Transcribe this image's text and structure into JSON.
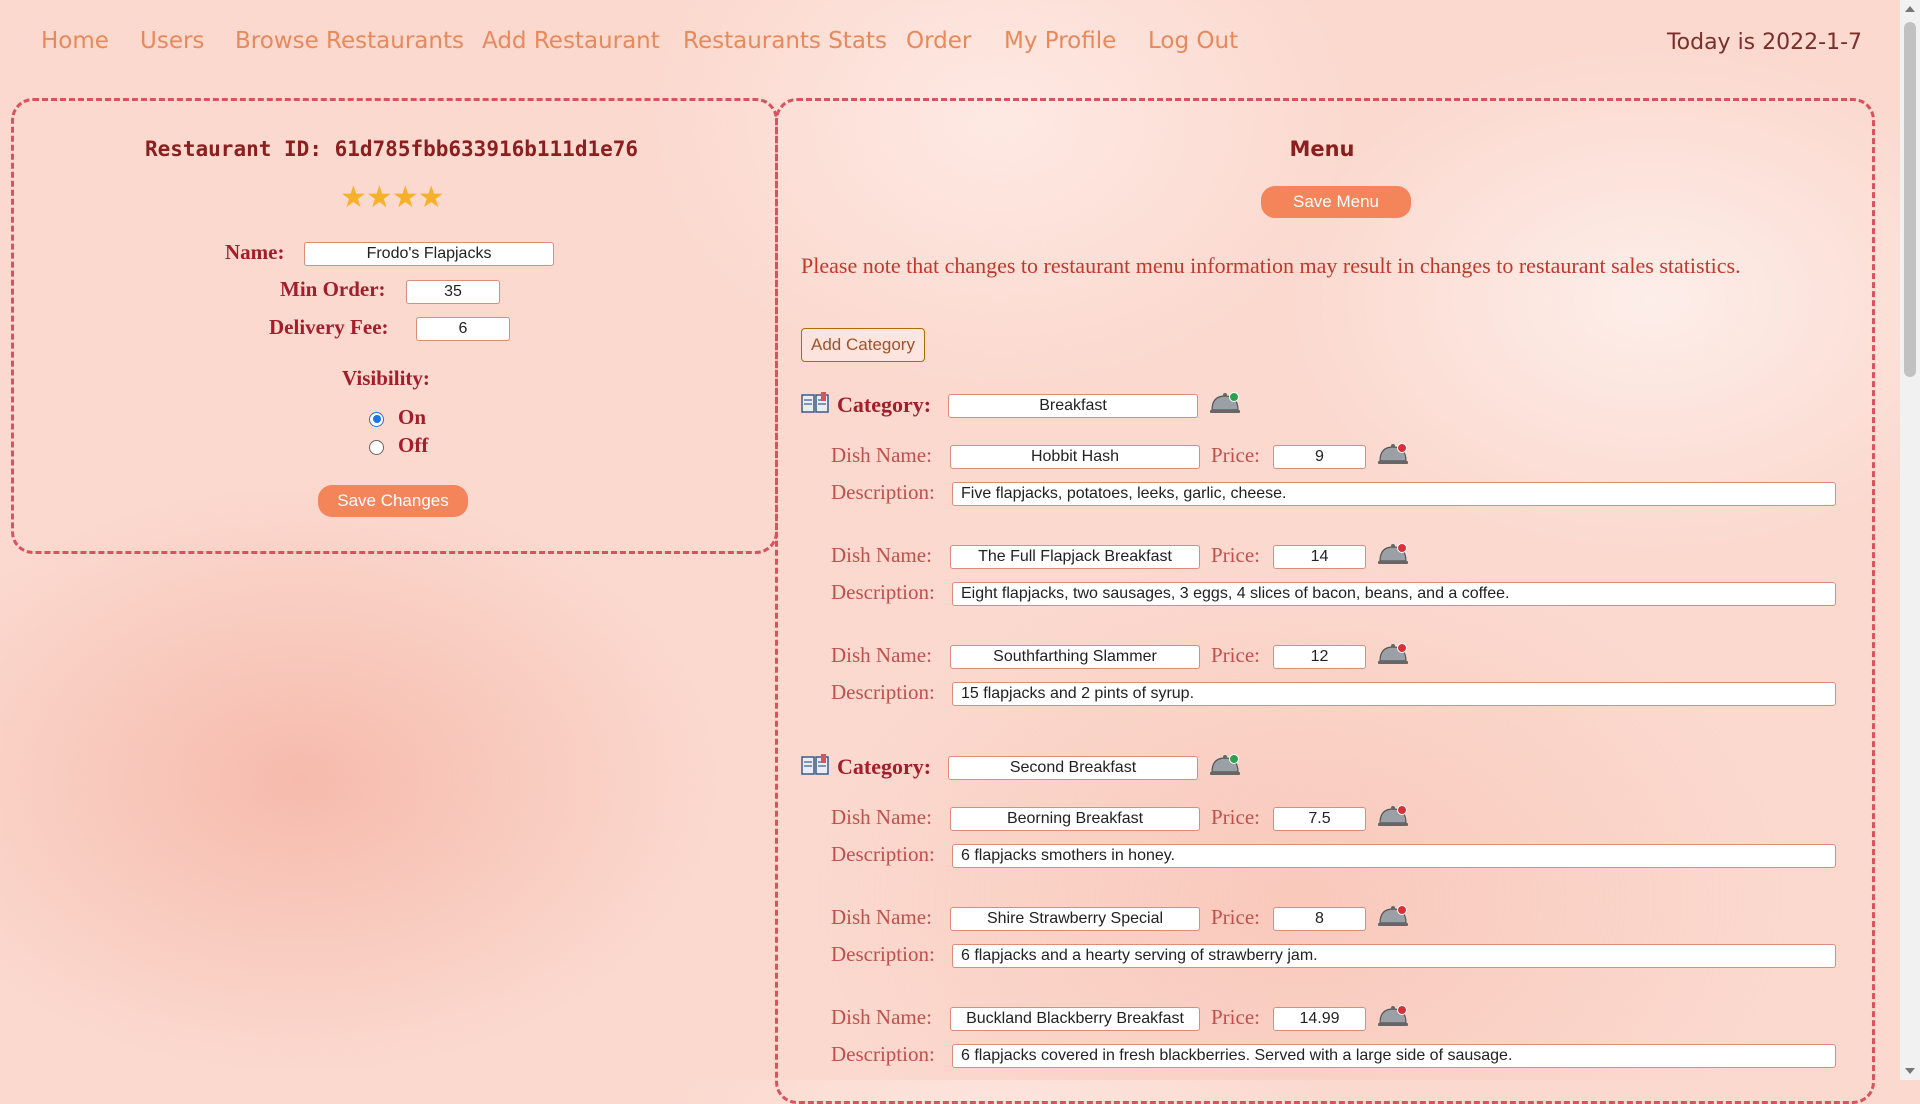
{
  "nav": {
    "home": "Home",
    "users": "Users",
    "browse": "Browse Restaurants",
    "add": "Add Restaurant",
    "stats": "Restaurants Stats",
    "order": "Order",
    "profile": "My Profile",
    "logout": "Log Out"
  },
  "date_text": "Today is 2022-1-7",
  "restaurant": {
    "id_text": "Restaurant ID: 61d785fbb633916b111d1e76",
    "rating_stars": 4,
    "name_label": "Name:",
    "name_value": "Frodo's Flapjacks",
    "min_order_label": "Min Order:",
    "min_order_value": "35",
    "delivery_fee_label": "Delivery Fee:",
    "delivery_fee_value": "6",
    "visibility_label": "Visibility:",
    "on_label": "On",
    "off_label": "Off",
    "visibility": "On",
    "save_label": "Save Changes"
  },
  "menu": {
    "title": "Menu",
    "save_label": "Save Menu",
    "notice": "Please note that changes to restaurant menu information may result in changes to restaurant sales statistics.",
    "add_category_label": "Add Category",
    "category_label": "Category:",
    "dish_name_label": "Dish Name:",
    "price_label": "Price:",
    "description_label": "Description:",
    "categories": [
      {
        "name": "Breakfast",
        "dishes": [
          {
            "name": "Hobbit Hash",
            "price": "9",
            "description": "Five flapjacks, potatoes, leeks, garlic, cheese."
          },
          {
            "name": "The Full Flapjack Breakfast",
            "price": "14",
            "description": "Eight flapjacks, two sausages, 3 eggs, 4 slices of bacon, beans, and a coffee."
          },
          {
            "name": "Southfarthing Slammer",
            "price": "12",
            "description": "15 flapjacks and 2 pints of syrup."
          }
        ]
      },
      {
        "name": "Second Breakfast",
        "dishes": [
          {
            "name": "Beorning Breakfast",
            "price": "7.5",
            "description": "6 flapjacks smothers in honey."
          },
          {
            "name": "Shire Strawberry Special",
            "price": "8",
            "description": "6 flapjacks and a hearty serving of strawberry jam."
          },
          {
            "name": "Buckland Blackberry Breakfast",
            "price": "14.99",
            "description": "6 flapjacks covered in fresh blackberries. Served with a large side of sausage."
          }
        ]
      }
    ]
  },
  "colors": {
    "nav_link": "#e8895c",
    "accent_button": "#f4845a",
    "label_red": "#a31d2a",
    "panel_border": "#d9535e"
  }
}
